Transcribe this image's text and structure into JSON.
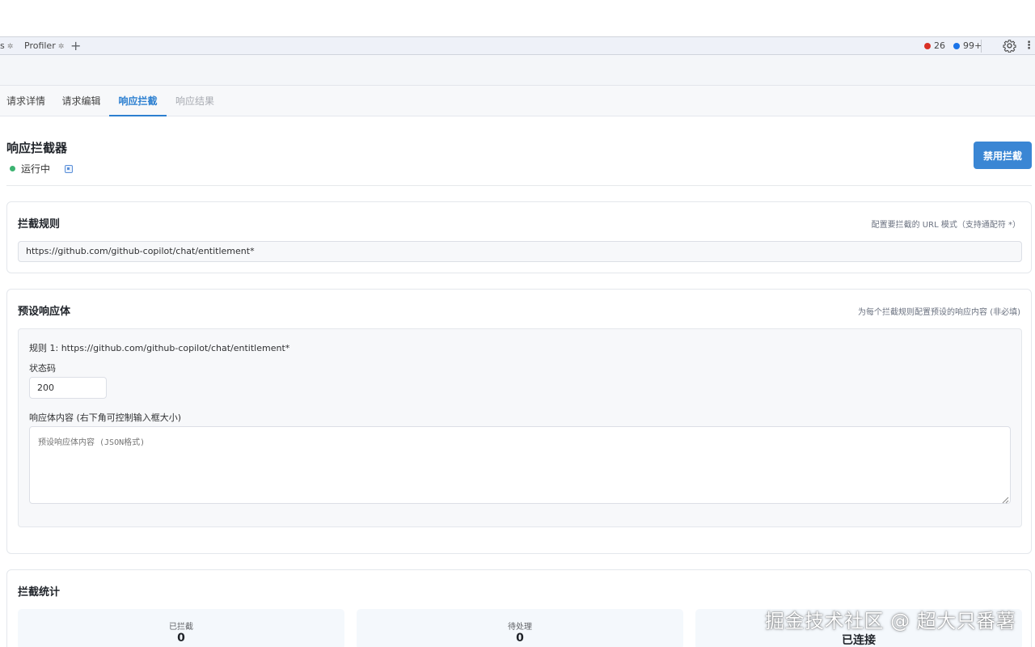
{
  "devtools": {
    "tabs": [
      {
        "label": "s",
        "icon": "gear-icon"
      },
      {
        "label": "Profiler",
        "icon": "gear-icon"
      }
    ],
    "add_tab": "+",
    "error_count": "26",
    "message_count": "99+"
  },
  "tabs": [
    {
      "label": "请求详情",
      "state": "normal"
    },
    {
      "label": "请求编辑",
      "state": "normal"
    },
    {
      "label": "响应拦截",
      "state": "active"
    },
    {
      "label": "响应结果",
      "state": "disabled"
    }
  ],
  "header": {
    "title": "响应拦截器",
    "status": "运行中",
    "disable_button": "禁用拦截"
  },
  "rules_card": {
    "title": "拦截规则",
    "hint": "配置要拦截的 URL 模式（支持通配符 *）",
    "rule_value": "https://github.com/github-copilot/chat/entitlement*"
  },
  "preset_card": {
    "title": "预设响应体",
    "hint": "为每个拦截规则配置预设的响应内容 (非必填)",
    "rule_label": "规则 1: https://github.com/github-copilot/chat/entitlement*",
    "status_label": "状态码",
    "status_value": "200",
    "body_label": "响应体内容 (右下角可控制输入框大小)",
    "body_placeholder": "预设响应体内容 (JSON格式)"
  },
  "stats_card": {
    "title": "拦截统计",
    "items": [
      {
        "label": "已拦截",
        "value": "0"
      },
      {
        "label": "待处理",
        "value": "0"
      },
      {
        "label": "",
        "value": "已连接"
      }
    ]
  },
  "watermark": "掘金技术社区 @ 超大只番薯",
  "colors": {
    "accent": "#2c7fd0",
    "button": "#3a86d4",
    "status_running": "#3cb371",
    "error": "#d93025",
    "info": "#1a73e8"
  }
}
